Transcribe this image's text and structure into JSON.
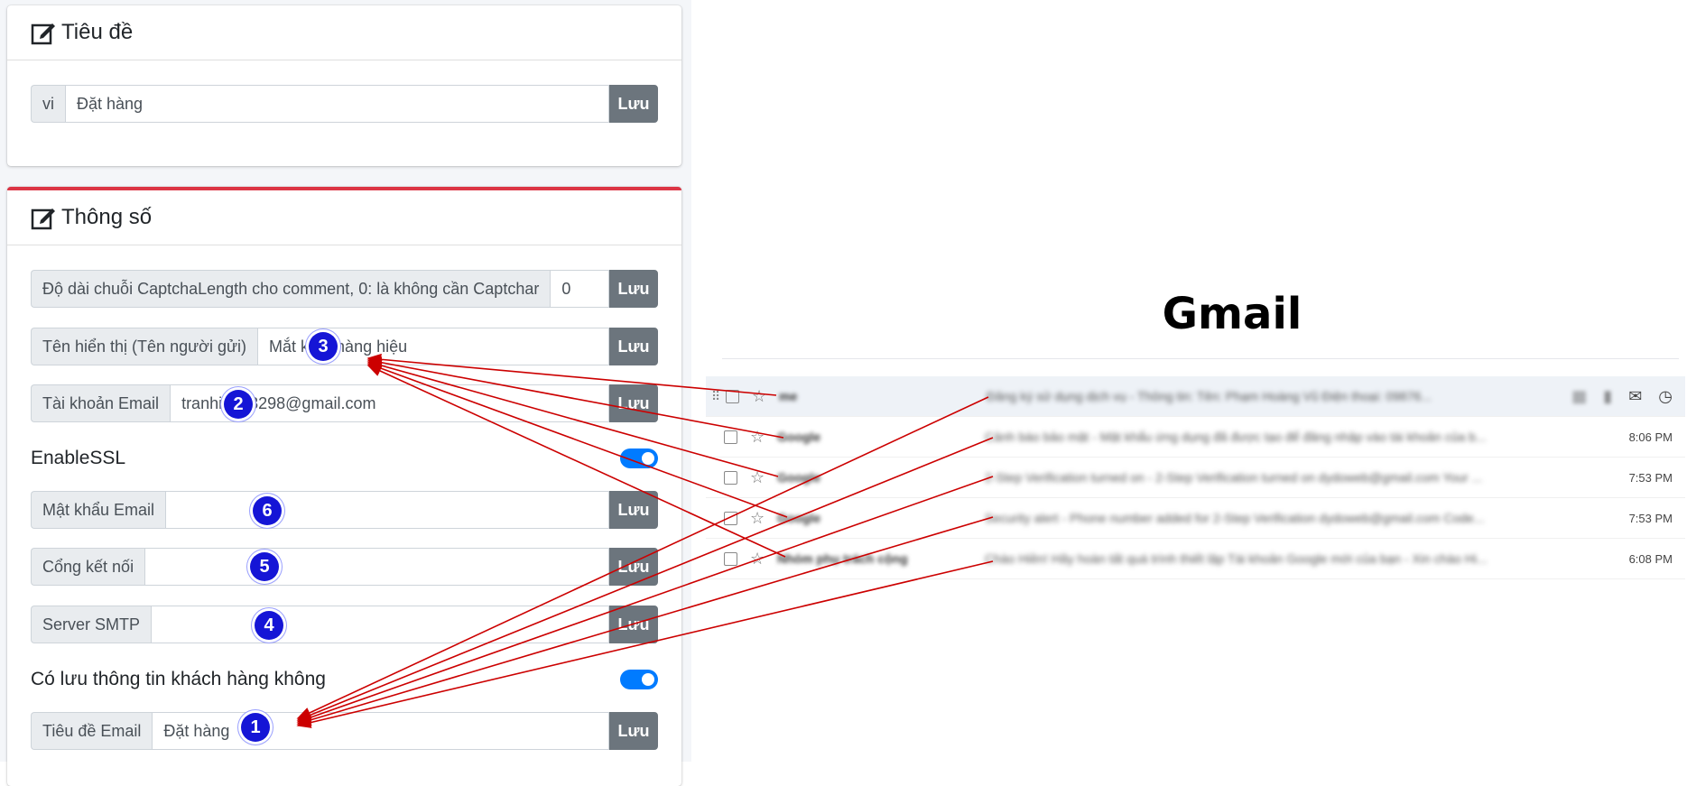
{
  "title_card": {
    "header": "Tiêu đề",
    "row": {
      "prepend": "vi",
      "value": "Đặt hàng",
      "save": "Lưu"
    }
  },
  "params_card": {
    "header": "Thông số",
    "rows": [
      {
        "prepend": "Độ dài chuỗi CaptchaLength cho comment, 0: là không cần Captchar",
        "value": "0",
        "save": "Lưu"
      },
      {
        "prepend": "Tên hiển thị (Tên người gửi)",
        "value": "Mắt kính hàng hiệu",
        "save": "Lưu"
      },
      {
        "prepend": "Tài khoản Email",
        "value": "tranhieu03298@gmail.com",
        "save": "Lưu"
      },
      {
        "prepend": "Mật khẩu Email",
        "value": "",
        "save": "Lưu"
      },
      {
        "prepend": "Cổng kết nối",
        "value": "",
        "save": "Lưu"
      },
      {
        "prepend": "Server SMTP",
        "value": "",
        "save": "Lưu"
      },
      {
        "prepend": "Tiêu đề Email",
        "value": "Đặt hàng",
        "save": "Lưu"
      }
    ],
    "switches": [
      {
        "label": "EnableSSL",
        "on": true
      },
      {
        "label": "Có lưu thông tin khách hàng không",
        "on": true
      }
    ]
  },
  "badges": [
    "1",
    "2",
    "3",
    "4",
    "5",
    "6"
  ],
  "gmail": {
    "title": "Gmail",
    "rows": [
      {
        "sender": "me",
        "snippet": "Đăng ký sử dụng dịch vụ - Thông tin: Tên: Phạm Hoàng Vũ Điện thoại: 09876...",
        "time": ""
      },
      {
        "sender": "Google",
        "snippet": "Cảnh báo bảo mật - Mật khẩu ứng dụng đã được tạo để đăng nhập vào tài khoản của b...",
        "time": "8:06 PM"
      },
      {
        "sender": "Google",
        "snippet": "2-Step Verification turned on - 2-Step Verification turned on dydoweb@gmail.com Your ...",
        "time": "7:53 PM"
      },
      {
        "sender": "Google",
        "snippet": "Security alert - Phone number added for 2-Step Verification dydoweb@gmail.com Code...",
        "time": "7:53 PM"
      },
      {
        "sender": "Nhóm phụ trách cộng",
        "snippet": "Chào Hiền! Hãy hoàn tất quá trình thiết lập Tài khoản Google mới của bạn - Xin chào Hi...",
        "time": "6:08 PM"
      }
    ]
  },
  "colors": {
    "accent": "#007bff",
    "save_button": "#6c757d",
    "badge": "#1515d6",
    "arrow": "#cc0000",
    "card_top_border": "#dc3545"
  }
}
